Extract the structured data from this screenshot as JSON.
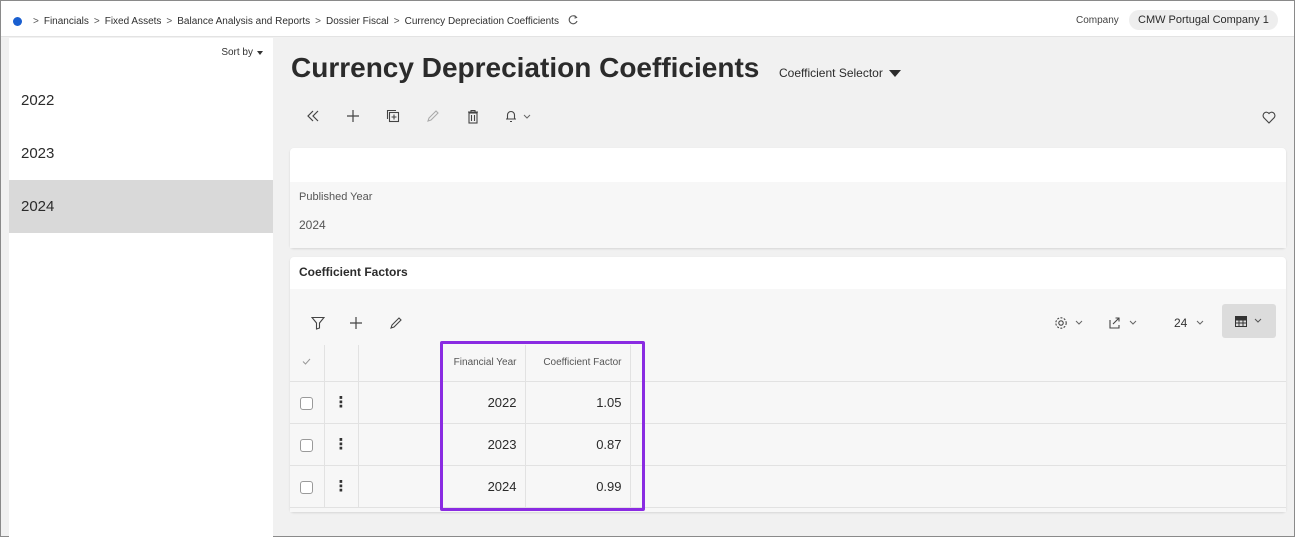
{
  "breadcrumb": {
    "items": [
      "Financials",
      "Fixed Assets",
      "Balance Analysis and Reports",
      "Dossier Fiscal",
      "Currency Depreciation Coefficients"
    ],
    "separator": ">"
  },
  "company": {
    "label": "Company",
    "value": "CMW Portugal Company 1"
  },
  "left_panel": {
    "sort_label": "Sort by",
    "years": [
      "2022",
      "2023",
      "2024"
    ],
    "selected": "2024"
  },
  "page": {
    "title": "Currency Depreciation Coefficients",
    "selector_label": "Coefficient Selector"
  },
  "toolbar": {
    "icons": [
      "collapse-icon",
      "add-icon",
      "duplicate-icon",
      "edit-icon",
      "delete-icon",
      "notification-icon",
      "favorite-icon"
    ]
  },
  "header_card": {
    "field_label": "Published Year",
    "field_value": "2024"
  },
  "coefficient_factors": {
    "title": "Coefficient Factors",
    "page_size": "24",
    "columns": [
      "Financial Year",
      "Coefficient Factor"
    ],
    "rows": [
      {
        "financial_year": "2022",
        "coefficient_factor": "1.05"
      },
      {
        "financial_year": "2023",
        "coefficient_factor": "0.87"
      },
      {
        "financial_year": "2024",
        "coefficient_factor": "0.99"
      }
    ]
  },
  "colors": {
    "accent_dot": "#1a5fd0",
    "highlight_box": "#8a2be2",
    "selected_row": "#d9d9d9"
  }
}
